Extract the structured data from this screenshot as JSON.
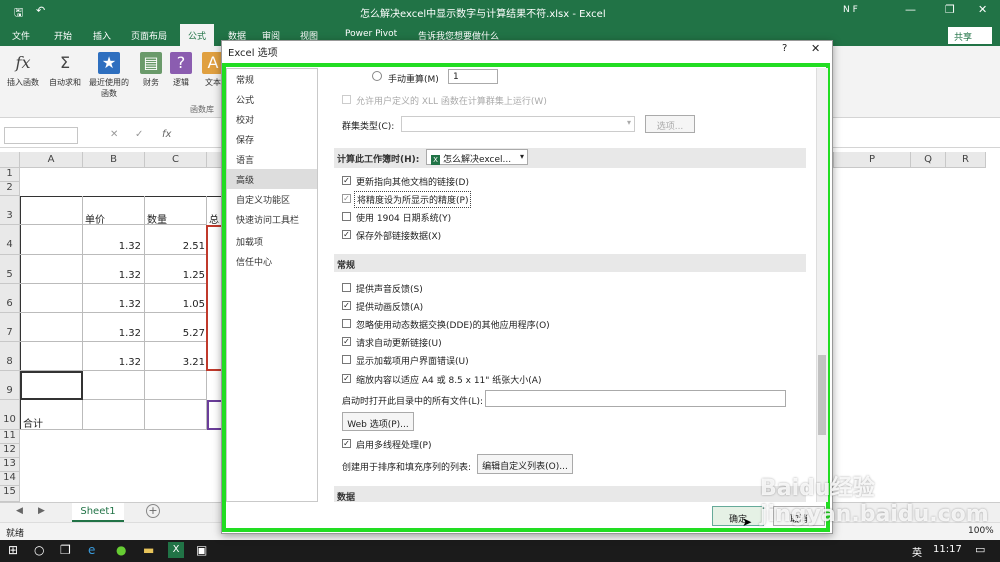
{
  "window": {
    "title": "怎么解决excel中显示数字与计算结果不符.xlsx - Excel",
    "user": "N F"
  },
  "ribbon_tabs": [
    "文件",
    "开始",
    "插入",
    "页面布局",
    "公式",
    "数据",
    "审阅",
    "视图",
    "Power Pivot"
  ],
  "tell_me": "告诉我您想要做什么",
  "share": "共享",
  "ribbon_buttons": [
    {
      "label": "插入函数"
    },
    {
      "label": "自动求和"
    },
    {
      "label": "最近使用的函数"
    },
    {
      "label": "财务"
    },
    {
      "label": "逻辑"
    },
    {
      "label": "文本"
    }
  ],
  "group_label": "函数库",
  "columns": [
    "A",
    "B",
    "C",
    "P",
    "Q",
    "R"
  ],
  "rows": {
    "nums": [
      "1",
      "2",
      "3",
      "4",
      "5",
      "6",
      "7",
      "8",
      "9",
      "10",
      "11",
      "12",
      "13",
      "14",
      "15"
    ],
    "header_b": "单价",
    "header_c": "数量",
    "header_d": "总",
    "prices": [
      "1.32",
      "1.32",
      "1.32",
      "1.32",
      "1.32"
    ],
    "qty": [
      "2.51",
      "1.25",
      "1.05",
      "5.27",
      "3.21"
    ],
    "total_label": "合计"
  },
  "sheet_tab": "Sheet1",
  "status": {
    "ready": "就绪",
    "zoom": "100%"
  },
  "dialog": {
    "title": "Excel 选项",
    "help": "?",
    "close": "✕",
    "nav": [
      "常规",
      "公式",
      "校对",
      "保存",
      "语言",
      "高级",
      "自定义功能区",
      "快速访问工具栏",
      "加载项",
      "信任中心"
    ],
    "manual_calc": "手动重算(M)",
    "manual_value": "1",
    "xll": "允许用户定义的 XLL 函数在计算群集上运行(W)",
    "cluster_type": "群集类型(C):",
    "options_btn": "选项...",
    "section_calc": "计算此工作簿时(H):",
    "workbook": "怎么解决excel...",
    "calc_opts": [
      {
        "label": "更新指向其他文档的链接(D)",
        "checked": true
      },
      {
        "label": "将精度设为所显示的精度(P)",
        "checked": true
      },
      {
        "label": "使用 1904 日期系统(Y)",
        "checked": false
      },
      {
        "label": "保存外部链接数据(X)",
        "checked": true
      }
    ],
    "section_general": "常规",
    "general_opts": [
      {
        "label": "提供声音反馈(S)",
        "checked": false
      },
      {
        "label": "提供动画反馈(A)",
        "checked": true
      },
      {
        "label": "忽略使用动态数据交换(DDE)的其他应用程序(O)",
        "checked": false
      },
      {
        "label": "请求自动更新链接(U)",
        "checked": true
      },
      {
        "label": "显示加载项用户界面错误(U)",
        "checked": false
      },
      {
        "label": "缩放内容以适应 A4 或 8.5 x 11\" 纸张大小(A)",
        "checked": true
      }
    ],
    "startup_label": "启动时打开此目录中的所有文件(L):",
    "web_btn": "Web 选项(P)...",
    "multithread": "启用多线程处理(P)",
    "list_label": "创建用于排序和填充序列的列表:",
    "edit_list_btn": "编辑自定义列表(O)...",
    "section_data": "数据",
    "ok": "确定",
    "cancel": "取消"
  },
  "taskbar": {
    "time": "11:17",
    "lang": "英"
  },
  "watermark": "Baidu经验 jingyan.baidu.com"
}
